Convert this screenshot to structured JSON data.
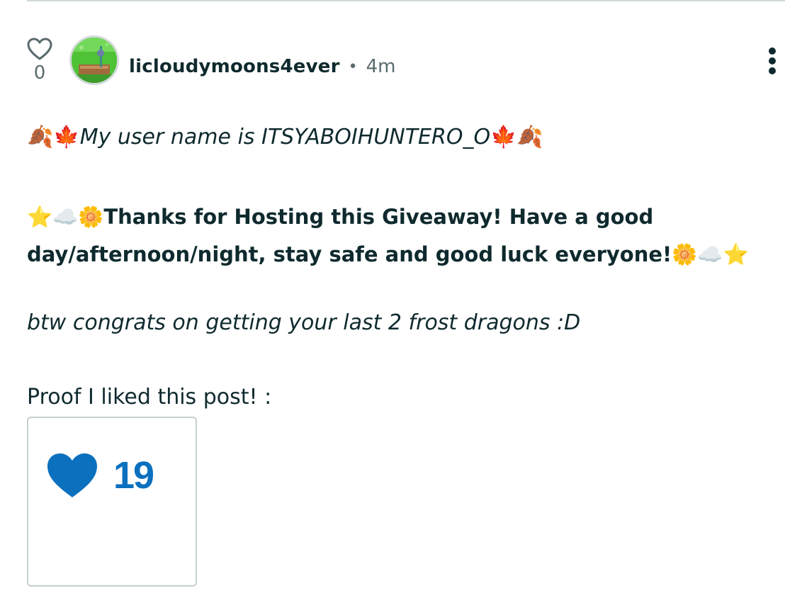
{
  "post": {
    "like_count": "0",
    "author": {
      "username": "licloudymoons4ever",
      "separator": "•",
      "time_ago": "4m"
    },
    "menu_icon": "more-vertical-icon",
    "content": {
      "username_line": {
        "emoji_left": "🍂🍁",
        "text": "My user name is ITSYABOIHUNTERO_O",
        "emoji_right": "🍁🍂"
      },
      "thanks": {
        "emoji_left": "⭐☁️🌼",
        "text": "Thanks for Hosting this Giveaway! Have a good day/afternoon/night, stay safe and good luck everyone!",
        "emoji_right": "🌼☁️⭐"
      },
      "congrats": "btw congrats on getting your last 2 frost dragons :D",
      "proof_label": "Proof I liked this post! :",
      "proof_image": {
        "icon": "heart-filled-icon",
        "count": "19",
        "accent_color": "#0b70be"
      }
    }
  },
  "colors": {
    "text": "#0f2a2e",
    "muted": "#5a6b6e",
    "divider": "#cfd8da"
  }
}
